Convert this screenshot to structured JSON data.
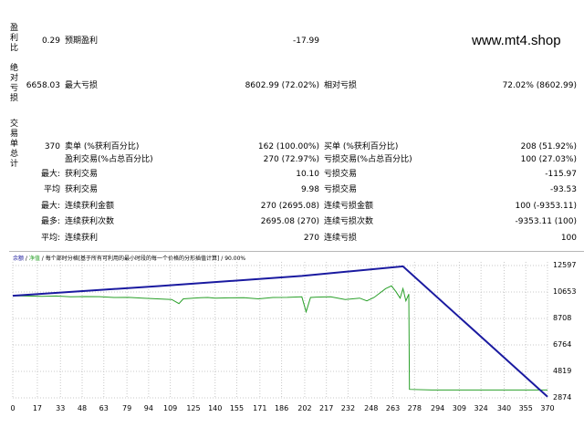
{
  "watermark": "www.mt4.shop",
  "report": {
    "group_profit_ratio": "盈利比",
    "group_absolute_drawdown": "绝对亏损",
    "group_trade_totals": "交易单总计",
    "row1": {
      "left_value": "0.29",
      "label": "预期盈利",
      "value": "-17.99"
    },
    "row2": {
      "left_value": "6658.03",
      "label": "最大亏损",
      "value": "8602.99 (72.02%)",
      "label2": "相对亏损",
      "value2": "72.02% (8602.99)"
    },
    "row3": {
      "left_value": "370",
      "label": "卖单 (%获利百分比)",
      "value": "162 (100.00%)",
      "label2": "买单 (%获利百分比)",
      "value2": "208 (51.92%)"
    },
    "row4": {
      "label": "盈利交易(%占总百分比)",
      "value": "270 (72.97%)",
      "label2": "亏损交易(%占总百分比)",
      "value2": "100 (27.03%)"
    },
    "row5": {
      "prefix": "最大:",
      "label": "获利交易",
      "value": "10.10",
      "label2": "亏损交易",
      "value2": "-115.97"
    },
    "row6": {
      "prefix": "平均",
      "label": "获利交易",
      "value": "9.98",
      "label2": "亏损交易",
      "value2": "-93.53"
    },
    "row7": {
      "prefix": "最大:",
      "label": "连续获利金额",
      "value": "270 (2695.08)",
      "label2": "连续亏损金额",
      "value2": "100 (-9353.11)"
    },
    "row8": {
      "prefix": "最多:",
      "label": "连续获利次数",
      "value": "2695.08 (270)",
      "label2": "连续亏损次数",
      "value2": "-9353.11 (100)"
    },
    "row9": {
      "prefix": "平均:",
      "label": "连续获利",
      "value": "270",
      "label2": "连续亏损",
      "value2": "100"
    }
  },
  "chart_data": {
    "type": "line",
    "legend": {
      "balance": "余额",
      "sep": " / ",
      "equity": "净值",
      "note": " / 每个部时分格[基于所有可利用的最小时段的每一个价格的分形插值计算] / 90.00%"
    },
    "colors": {
      "balance": "#1a1aa0",
      "equity": "#2aa02a",
      "grid": "#c8c8c8"
    },
    "x_ticks": [
      "0",
      "17",
      "33",
      "48",
      "63",
      "79",
      "94",
      "109",
      "125",
      "140",
      "155",
      "171",
      "186",
      "202",
      "217",
      "232",
      "248",
      "263",
      "278",
      "294",
      "309",
      "324",
      "340",
      "355",
      "370"
    ],
    "y_ticks": [
      "12597",
      "10653",
      "8708",
      "6764",
      "4819",
      "2874"
    ],
    "ylim": [
      2874,
      12597
    ],
    "xlim": [
      0,
      370
    ],
    "series": [
      {
        "name": "余额",
        "points": [
          [
            0,
            10380
          ],
          [
            100,
            11080
          ],
          [
            200,
            11830
          ],
          [
            270,
            12540
          ],
          [
            370,
            2960
          ]
        ]
      },
      {
        "name": "净值",
        "points": [
          [
            0,
            10380
          ],
          [
            10,
            10360
          ],
          [
            20,
            10340
          ],
          [
            30,
            10360
          ],
          [
            40,
            10300
          ],
          [
            50,
            10320
          ],
          [
            60,
            10310
          ],
          [
            70,
            10250
          ],
          [
            80,
            10260
          ],
          [
            90,
            10200
          ],
          [
            100,
            10150
          ],
          [
            110,
            10100
          ],
          [
            115,
            9800
          ],
          [
            118,
            10150
          ],
          [
            125,
            10200
          ],
          [
            130,
            10230
          ],
          [
            135,
            10250
          ],
          [
            140,
            10200
          ],
          [
            150,
            10220
          ],
          [
            160,
            10230
          ],
          [
            170,
            10150
          ],
          [
            180,
            10250
          ],
          [
            190,
            10260
          ],
          [
            200,
            10300
          ],
          [
            203,
            9200
          ],
          [
            206,
            10250
          ],
          [
            210,
            10280
          ],
          [
            220,
            10300
          ],
          [
            230,
            10100
          ],
          [
            240,
            10200
          ],
          [
            245,
            10000
          ],
          [
            250,
            10250
          ],
          [
            258,
            10900
          ],
          [
            262,
            11100
          ],
          [
            265,
            10700
          ],
          [
            268,
            10200
          ],
          [
            270,
            10900
          ],
          [
            272,
            10000
          ],
          [
            274,
            10500
          ],
          [
            274.5,
            3500
          ],
          [
            290,
            3450
          ],
          [
            330,
            3450
          ],
          [
            360,
            3450
          ],
          [
            370,
            3450
          ]
        ]
      }
    ]
  }
}
